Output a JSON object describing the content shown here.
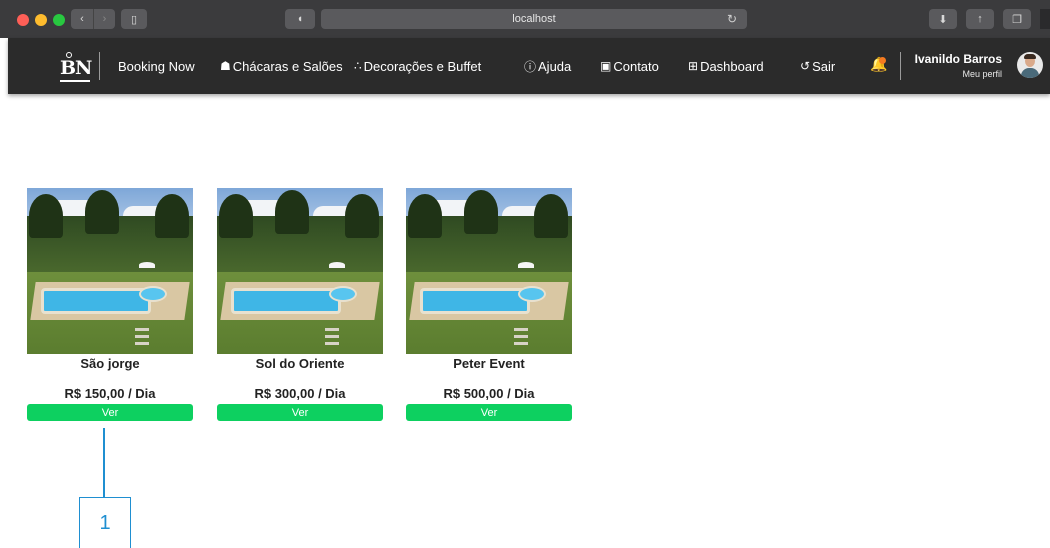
{
  "browser": {
    "address": "localhost",
    "icons": {
      "back": "chevron-left-icon",
      "forward": "chevron-right-icon",
      "sidebar": "sidebar-icon",
      "privacy": "shield-icon",
      "reload": "reload-icon",
      "download": "download-icon",
      "share": "share-icon",
      "tabs": "tabs-icon"
    }
  },
  "navbar": {
    "logo_text": "BN",
    "brand": "Booking Now",
    "items": [
      {
        "label": "Chácaras e Salões",
        "icon": "building-icon"
      },
      {
        "label": "Decorações e Buffet",
        "icon": "sparkles-icon"
      },
      {
        "label": "Ajuda",
        "icon": "help-icon"
      },
      {
        "label": "Contato",
        "icon": "contact-icon"
      },
      {
        "label": "Dashboard",
        "icon": "dashboard-icon"
      },
      {
        "label": "Sair",
        "icon": "logout-icon"
      }
    ],
    "notification_color": "#f47a20",
    "user": {
      "name": "Ivanildo Barros",
      "subtitle": "Meu perfil"
    }
  },
  "listings": [
    {
      "title": "São jorge",
      "price": "R$ 150,00 / Dia",
      "button": "Ver"
    },
    {
      "title": "Sol do Oriente",
      "price": "R$ 300,00 / Dia",
      "button": "Ver"
    },
    {
      "title": "Peter Event",
      "price": "R$ 500,00 / Dia",
      "button": "Ver"
    }
  ],
  "colors": {
    "navbar_bg": "#2b2b2b",
    "button_green": "#0dd060",
    "annotation_blue": "#1f8fd1"
  },
  "annotation": {
    "label": "1"
  }
}
